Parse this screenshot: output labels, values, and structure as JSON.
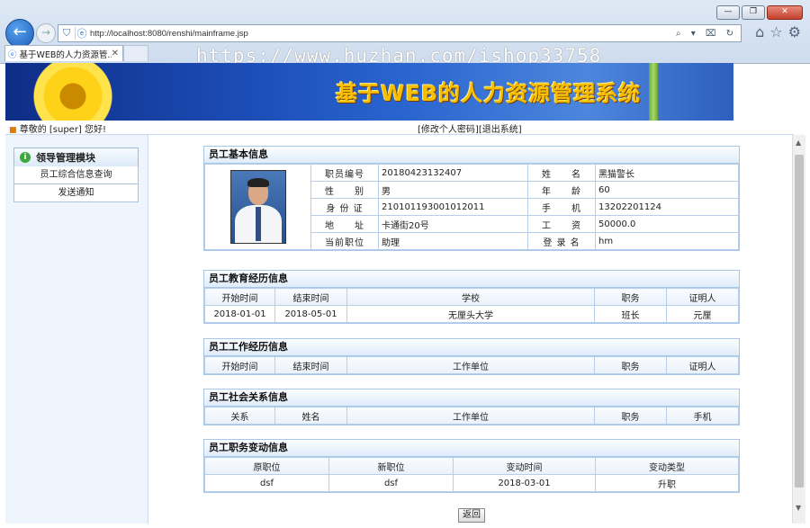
{
  "browser": {
    "window_controls": [
      "—",
      "❐",
      "✕"
    ],
    "url": "http://localhost:8080/renshi/mainframe.jsp",
    "address_tools": "⌕ ▾ ⌧ ↻",
    "tab_title": "基于WEB的人力资源管...",
    "tab_close": "✕",
    "watermark": "https://www.huzhan.com/ishop33758"
  },
  "banner": {
    "title": "基于WEB的人力资源管理系统"
  },
  "topbar": {
    "greeting": "尊敬的 [super] 您好!",
    "edit_password": "[修改个人密码]",
    "logout": "[退出系统]"
  },
  "sidebar": {
    "module_title": "领导管理模块",
    "items": [
      {
        "label": "员工综合信息查询"
      },
      {
        "label": "发送通知"
      }
    ]
  },
  "basic_info": {
    "title": "员工基本信息",
    "rows": [
      {
        "l1": "职员编号",
        "v1": "20180423132407",
        "l2": "姓　　名",
        "v2": "黑猫警长"
      },
      {
        "l1": "性　　别",
        "v1": "男",
        "l2": "年　　龄",
        "v2": "60"
      },
      {
        "l1": "身 份 证",
        "v1": "210101193001012011",
        "l2": "手　　机",
        "v2": "13202201124"
      },
      {
        "l1": "地　　址",
        "v1": "卡通街20号",
        "l2": "工　　资",
        "v2": "50000.0"
      },
      {
        "l1": "当前职位",
        "v1": "助理",
        "l2": "登 录 名",
        "v2": "hm"
      }
    ]
  },
  "education": {
    "title": "员工教育经历信息",
    "headers": [
      "开始时间",
      "结束时间",
      "学校",
      "职务",
      "证明人"
    ],
    "rows": [
      [
        "2018-01-01",
        "2018-05-01",
        "无厘头大学",
        "班长",
        "元厘"
      ]
    ]
  },
  "work": {
    "title": "员工工作经历信息",
    "headers": [
      "开始时间",
      "结束时间",
      "工作单位",
      "职务",
      "证明人"
    ]
  },
  "social": {
    "title": "员工社会关系信息",
    "headers": [
      "关系",
      "姓名",
      "工作单位",
      "职务",
      "手机"
    ]
  },
  "position_change": {
    "title": "员工职务变动信息",
    "headers": [
      "原职位",
      "新职位",
      "变动时间",
      "变动类型"
    ],
    "rows": [
      [
        "dsf",
        "dsf",
        "2018-03-01",
        "升职"
      ]
    ]
  },
  "back_button": "返回",
  "colors": {
    "banner_blue": "#1d4fb9",
    "title_gold": "#f6c000",
    "panel_border": "#a8c6e6"
  }
}
